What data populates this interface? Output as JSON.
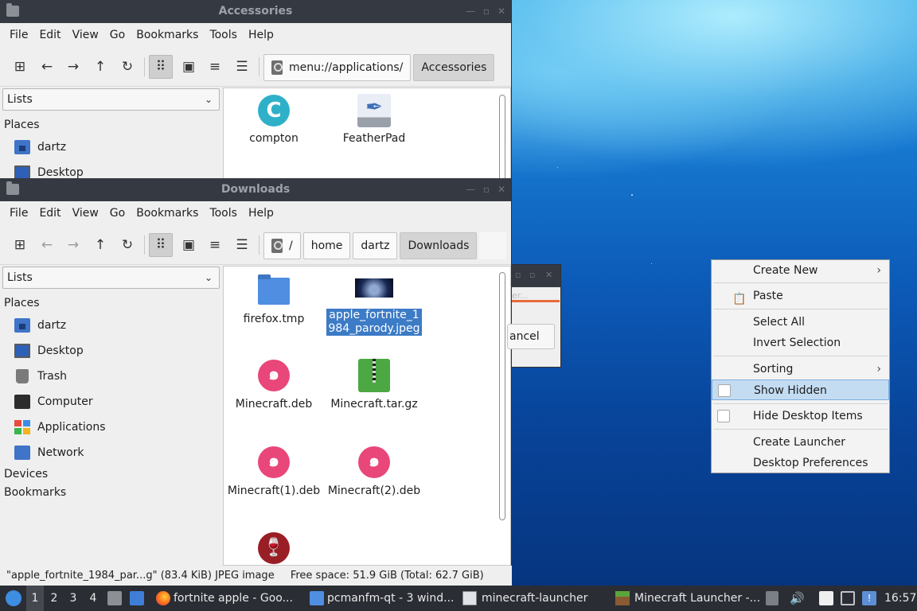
{
  "accessories_window": {
    "title": "Accessories",
    "menu": [
      "File",
      "Edit",
      "View",
      "Go",
      "Bookmarks",
      "Tools",
      "Help"
    ],
    "path_segments": [
      "menu://applications/",
      "Accessories"
    ],
    "side_combo": "Lists",
    "places_header": "Places",
    "places": [
      "dartz",
      "Desktop"
    ],
    "files": [
      {
        "name": "compton",
        "icon": "compton-icon"
      },
      {
        "name": "FeatherPad",
        "icon": "featherpad-icon"
      }
    ]
  },
  "downloads_window": {
    "title": "Downloads",
    "menu": [
      "File",
      "Edit",
      "View",
      "Go",
      "Bookmarks",
      "Tools",
      "Help"
    ],
    "path_segments": [
      "/",
      "home",
      "dartz",
      "Downloads"
    ],
    "side_combo": "Lists",
    "places_header": "Places",
    "places": [
      "dartz",
      "Desktop",
      "Trash",
      "Computer",
      "Applications",
      "Network"
    ],
    "devices_header": "Devices",
    "bookmarks_header": "Bookmarks",
    "files": [
      {
        "name": "firefox.tmp",
        "icon": "folder-icon"
      },
      {
        "name": "apple_fortnite_1984_parody.jpeg",
        "line1": "apple_fortnite_1",
        "line2": "984_parody.jpeg",
        "icon": "jpeg-thumbnail-icon",
        "selected": true
      },
      {
        "name": "Minecraft.deb",
        "icon": "debian-package-icon"
      },
      {
        "name": "Minecraft.tar.gz",
        "icon": "archive-icon"
      },
      {
        "name": "Minecraft(1).deb",
        "icon": "debian-package-icon"
      },
      {
        "name": "Minecraft(2).deb",
        "icon": "debian-package-icon"
      },
      {
        "name": "",
        "icon": "wine-icon"
      }
    ],
    "status": {
      "selection": "\"apple_fortnite_1984_par...g\" (83.4 KiB) JPEG image",
      "free_space": "Free space: 51.9 GiB (Total: 62.7 GiB)"
    }
  },
  "dialog": {
    "field_hint": "er...",
    "button": "ancel"
  },
  "context_menu": {
    "items": [
      {
        "label": "Create New",
        "submenu": true
      },
      {
        "label": "Paste",
        "icon": "clipboard-icon"
      },
      {
        "label": "Select All"
      },
      {
        "label": "Invert Selection"
      },
      {
        "label": "Sorting",
        "submenu": true
      },
      {
        "label": "Show Hidden",
        "checkbox": true,
        "checked": false,
        "highlighted": true
      },
      {
        "label": "Hide Desktop Items",
        "checkbox": true,
        "checked": false
      },
      {
        "label": "Create Launcher"
      },
      {
        "label": "Desktop Preferences"
      }
    ]
  },
  "taskbar": {
    "workspaces": [
      "1",
      "2",
      "3",
      "4"
    ],
    "current_workspace": "1",
    "tasks": [
      {
        "label": "fortnite apple - Goo...",
        "icon": "firefox-icon"
      },
      {
        "label": "pcmanfm-qt - 3 wind...",
        "icon": "folder-icon"
      },
      {
        "label": "minecraft-launcher",
        "icon": "window-icon"
      },
      {
        "label": "Minecraft Launcher -...",
        "icon": "minecraft-icon"
      }
    ],
    "clock": "16:57"
  },
  "colors": {
    "titlebar": "#353a42",
    "selection": "#3c7bc6",
    "menu_highlight": "#c4dcf2",
    "taskbar": "#2a2d33"
  }
}
